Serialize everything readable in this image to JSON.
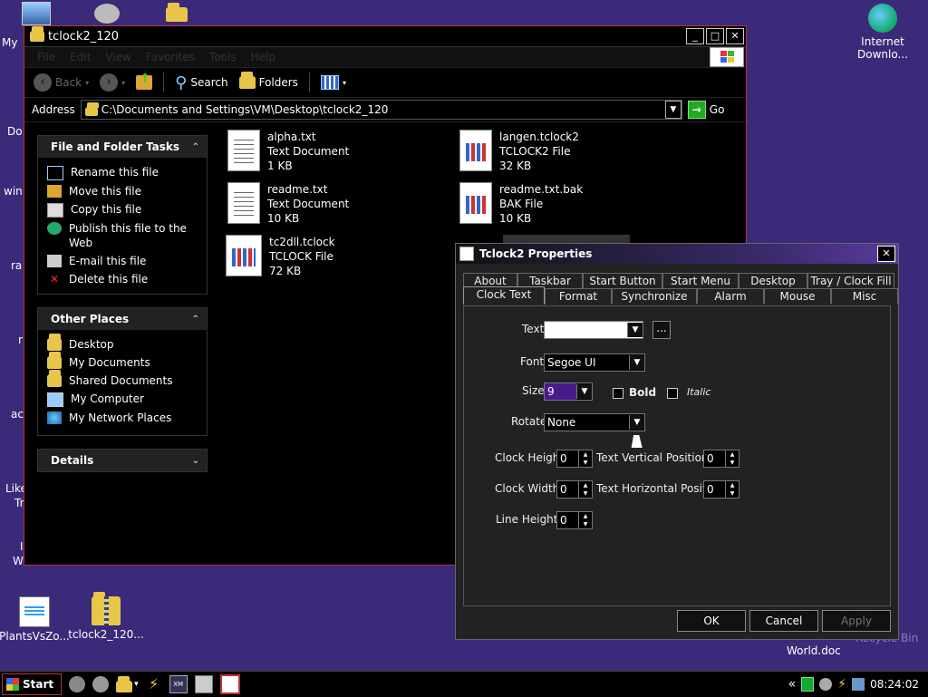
{
  "desktop": {
    "icons": [
      {
        "label": "Internet Downlo..."
      },
      {
        "label": "PlantsVsZo..."
      },
      {
        "label": "tclock2_120..."
      },
      {
        "label": "World.doc"
      },
      {
        "label": "Recycle Bin"
      }
    ],
    "partial_labels": [
      "My",
      "Do",
      "win",
      "ra",
      "r",
      "ac",
      "Like",
      "Tr",
      "I",
      "W"
    ]
  },
  "explorer": {
    "title": "tclock2_120",
    "menu": [
      "File",
      "Edit",
      "View",
      "Favorites",
      "Tools",
      "Help"
    ],
    "toolbar": {
      "back": "Back",
      "search": "Search",
      "folders": "Folders"
    },
    "address": {
      "label": "Address",
      "value": "C:\\Documents and Settings\\VM\\Desktop\\tclock2_120",
      "go": "Go"
    },
    "tasks": {
      "title": "File and Folder Tasks",
      "items": [
        "Rename this file",
        "Move this file",
        "Copy this file",
        "Publish this file to the Web",
        "E-mail this file",
        "Delete this file"
      ]
    },
    "places": {
      "title": "Other Places",
      "items": [
        "Desktop",
        "My Documents",
        "Shared Documents",
        "My Computer",
        "My Network Places"
      ]
    },
    "details": {
      "title": "Details"
    },
    "files": [
      {
        "name": "alpha.txt",
        "type": "Text Document",
        "size": "1 KB"
      },
      {
        "name": "langen.tclock2",
        "type": "TCLOCK2 File",
        "size": "32 KB"
      },
      {
        "name": "readme.txt",
        "type": "Text Document",
        "size": "10 KB"
      },
      {
        "name": "readme.txt.bak",
        "type": "BAK File",
        "size": "10 KB"
      },
      {
        "name": "tc2dll.tclock",
        "type": "TCLOCK File",
        "size": "72 KB"
      }
    ]
  },
  "dialog": {
    "title": "Tclock2 Properties",
    "tabs_back": [
      "About",
      "Taskbar",
      "Start Button",
      "Start Menu",
      "Desktop",
      "Tray / Clock Fill"
    ],
    "tabs_front": [
      "Clock Text",
      "Format",
      "Synchronize",
      "Alarm",
      "Mouse",
      "Misc"
    ],
    "fields": {
      "text_label": "Text",
      "text_value": "",
      "browse": "...",
      "font_label": "Font",
      "font_value": "Segoe UI",
      "size_label": "Size",
      "size_value": "9",
      "bold_label": "Bold",
      "italic_label": "Italic",
      "rotate_label": "Rotate",
      "rotate_value": "None",
      "clock_height_label": "Clock Height",
      "clock_height": "0",
      "text_vpos_label": "Text Vertical Position",
      "text_vpos": "0",
      "clock_width_label": "Clock Width",
      "clock_width": "0",
      "text_hpos_label": "Text Horizontal Position",
      "text_hpos": "0",
      "line_height_label": "Line Height",
      "line_height": "0"
    },
    "buttons": {
      "ok": "OK",
      "cancel": "Cancel",
      "apply": "Apply"
    }
  },
  "taskbar": {
    "start": "Start",
    "time": "08:24:02",
    "chevron": "«"
  },
  "colors": {
    "desktop": "#3b2a7a",
    "accent_border": "#bb3333",
    "size_highlight": "#4a1a8a"
  }
}
